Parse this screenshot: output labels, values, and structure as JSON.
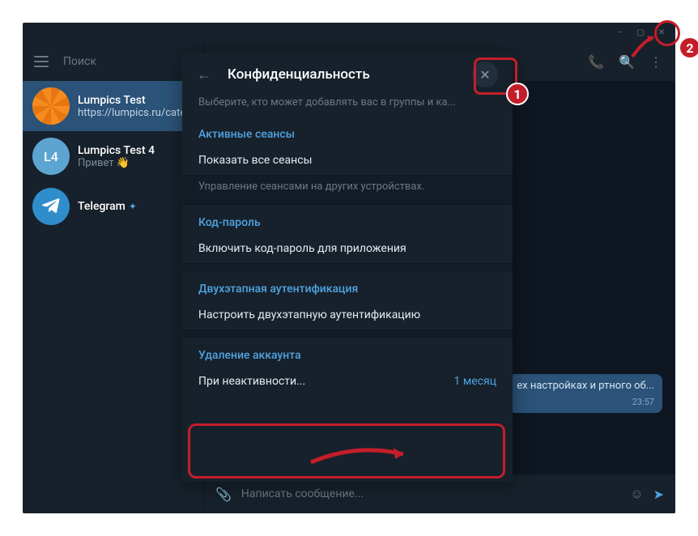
{
  "window": {
    "chat_title": "Lumpics Test"
  },
  "sidebar": {
    "search_placeholder": "Поиск",
    "chats": [
      {
        "name": "Lumpics Test",
        "preview": "https://lumpics.ru/cate",
        "avatar_label": "",
        "verified": false
      },
      {
        "name": "Lumpics Test 4",
        "preview": "Привет 👋",
        "avatar_label": "L4",
        "verified": false
      },
      {
        "name": "Telegram",
        "preview": "",
        "avatar_label": "",
        "verified": true
      }
    ]
  },
  "messages": {
    "last_text": "ех настройках и ртного об...",
    "last_time": "23:57"
  },
  "composer": {
    "placeholder": "Написать сообщение..."
  },
  "modal": {
    "title": "Конфиденциальность",
    "faded_hint": "Выберите, кто может добавлять вас в группы и ка...",
    "sections": {
      "sessions": {
        "header": "Активные сеансы",
        "item": "Показать все сеансы",
        "hint": "Управление сеансами на других устройствах."
      },
      "passcode": {
        "header": "Код-пароль",
        "item": "Включить код-пароль для приложения"
      },
      "twostep": {
        "header": "Двухэтапная аутентификация",
        "item": "Настроить двухэтапную аутентификацию"
      },
      "delete": {
        "header": "Удаление аккаунта",
        "item_label": "При неактивности...",
        "item_value": "1 месяц"
      }
    }
  },
  "annotations": {
    "badge1": "1",
    "badge2": "2"
  }
}
